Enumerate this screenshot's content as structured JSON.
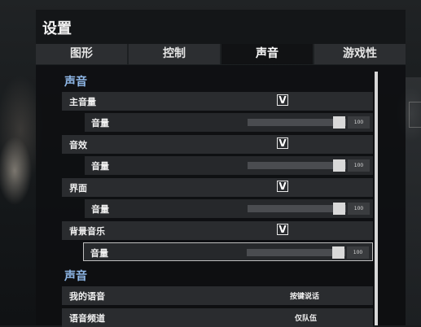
{
  "window": {
    "title": "设置"
  },
  "tabs": [
    {
      "label": "图形",
      "active": false
    },
    {
      "label": "控制",
      "active": false
    },
    {
      "label": "声音",
      "active": true
    },
    {
      "label": "游戏性",
      "active": false
    }
  ],
  "sections": [
    {
      "header": "声音",
      "groups": [
        {
          "label": "主音量",
          "checked": true,
          "volume_label": "音量",
          "volume_value": "100",
          "volume_level": 1.0
        },
        {
          "label": "音效",
          "checked": true,
          "volume_label": "音量",
          "volume_value": "100",
          "volume_level": 1.0
        },
        {
          "label": "界面",
          "checked": true,
          "volume_label": "音量",
          "volume_value": "100",
          "volume_level": 1.0
        },
        {
          "label": "背景音乐",
          "checked": true,
          "volume_label": "音量",
          "volume_value": "100",
          "volume_level": 1.0
        }
      ]
    },
    {
      "header": "声音",
      "options": [
        {
          "label": "我的语音",
          "value": "按键说话"
        },
        {
          "label": "语音频道",
          "value": "仅队伍"
        }
      ]
    }
  ],
  "check_glyph": "V",
  "colors": {
    "section_header": "#8fb8e8",
    "active_tab": "#111214",
    "row": "#2a2c2f"
  }
}
